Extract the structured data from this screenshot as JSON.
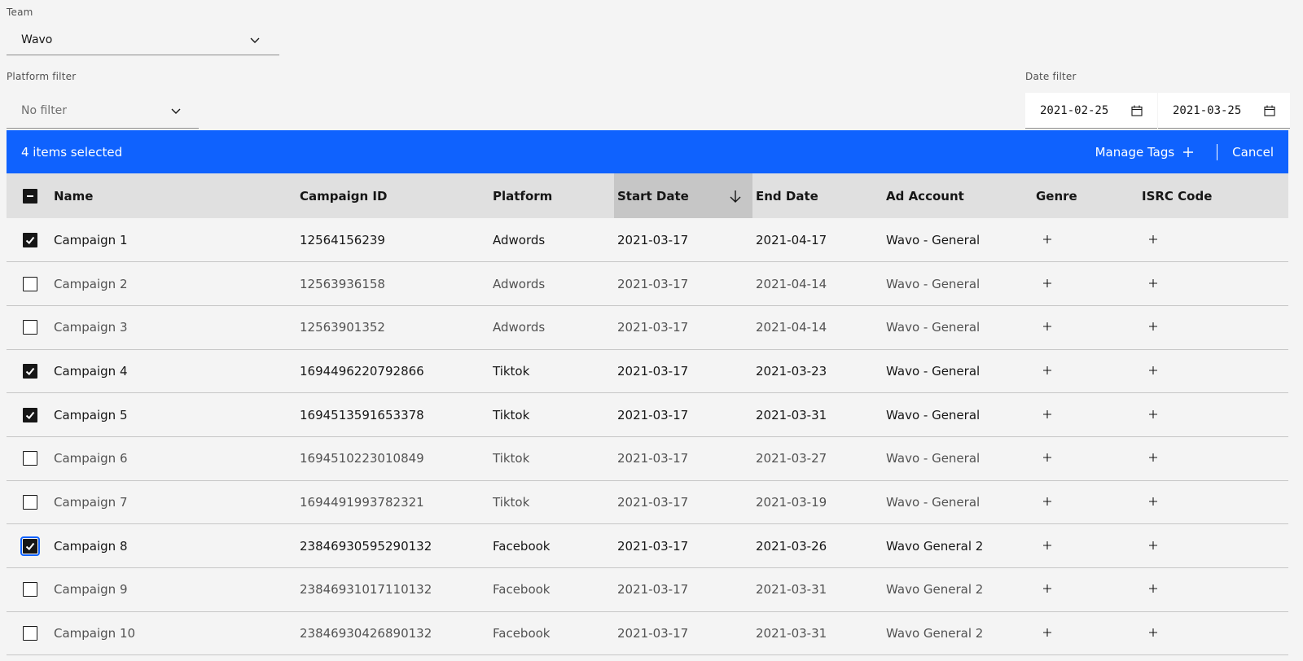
{
  "team": {
    "label": "Team",
    "value": "Wavo"
  },
  "platform_filter": {
    "label": "Platform filter",
    "value": "No filter"
  },
  "date_filter": {
    "label": "Date filter",
    "start": "2021-02-25",
    "end": "2021-03-25"
  },
  "toolbar": {
    "selected_text": "4 items selected",
    "manage_tags": "Manage Tags",
    "cancel": "Cancel",
    "accent": "#0f62fe"
  },
  "table": {
    "columns": [
      "Name",
      "Campaign ID",
      "Platform",
      "Start Date",
      "End Date",
      "Ad Account",
      "Genre",
      "ISRC Code"
    ],
    "sorted_column": "Start Date",
    "rows": [
      {
        "name": "Campaign 1",
        "campaign_id": "12564156239",
        "platform": "Adwords",
        "start": "2021-03-17",
        "end": "2021-04-17",
        "ad_account": "Wavo - General",
        "checked": true
      },
      {
        "name": "Campaign 2",
        "campaign_id": "12563936158",
        "platform": "Adwords",
        "start": "2021-03-17",
        "end": "2021-04-14",
        "ad_account": "Wavo - General",
        "checked": false
      },
      {
        "name": "Campaign 3",
        "campaign_id": "12563901352",
        "platform": "Adwords",
        "start": "2021-03-17",
        "end": "2021-04-14",
        "ad_account": "Wavo - General",
        "checked": false
      },
      {
        "name": "Campaign 4",
        "campaign_id": "1694496220792866",
        "platform": "Tiktok",
        "start": "2021-03-17",
        "end": "2021-03-23",
        "ad_account": "Wavo - General",
        "checked": true
      },
      {
        "name": "Campaign 5",
        "campaign_id": "1694513591653378",
        "platform": "Tiktok",
        "start": "2021-03-17",
        "end": "2021-03-31",
        "ad_account": "Wavo - General",
        "checked": true
      },
      {
        "name": "Campaign 6",
        "campaign_id": "1694510223010849",
        "platform": "Tiktok",
        "start": "2021-03-17",
        "end": "2021-03-27",
        "ad_account": "Wavo - General",
        "checked": false
      },
      {
        "name": "Campaign 7",
        "campaign_id": "1694491993782321",
        "platform": "Tiktok",
        "start": "2021-03-17",
        "end": "2021-03-19",
        "ad_account": "Wavo - General",
        "checked": false
      },
      {
        "name": "Campaign 8",
        "campaign_id": "23846930595290132",
        "platform": "Facebook",
        "start": "2021-03-17",
        "end": "2021-03-26",
        "ad_account": "Wavo General 2",
        "checked": true
      },
      {
        "name": "Campaign 9",
        "campaign_id": "23846931017110132",
        "platform": "Facebook",
        "start": "2021-03-17",
        "end": "2021-03-31",
        "ad_account": "Wavo General 2",
        "checked": false
      },
      {
        "name": "Campaign 10",
        "campaign_id": "23846930426890132",
        "platform": "Facebook",
        "start": "2021-03-17",
        "end": "2021-03-31",
        "ad_account": "Wavo General 2",
        "checked": false
      }
    ]
  }
}
